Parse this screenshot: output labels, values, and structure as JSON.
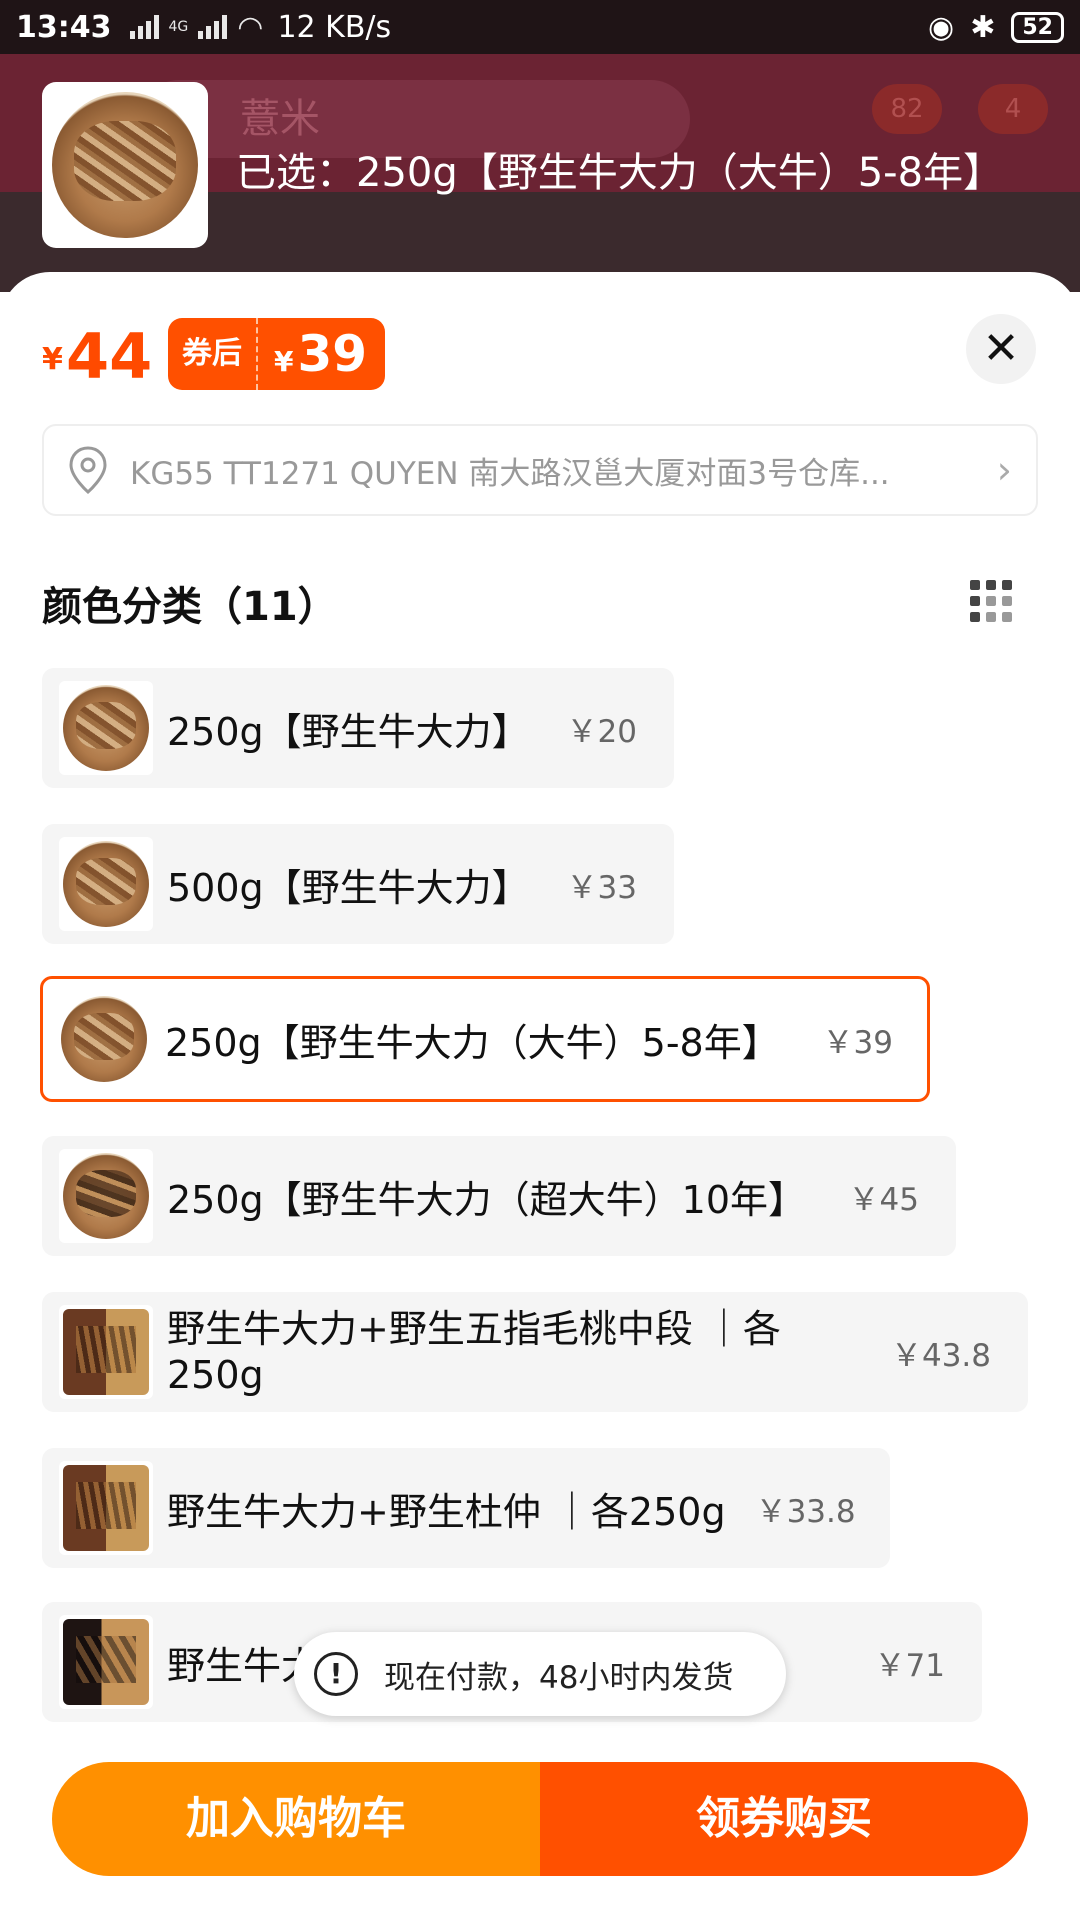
{
  "status_bar": {
    "time": "13:43",
    "network_speed": "12 KB/s",
    "battery": "52",
    "network_label": "4G"
  },
  "background_page": {
    "search_text": "薏米",
    "cart_badge": "82",
    "message_badge": "4"
  },
  "header": {
    "selected_text": "已选：250g【野生牛大力（大牛）5-8年】"
  },
  "price": {
    "currency": "¥",
    "current": "44",
    "coupon_label": "券后",
    "coupon_currency": "¥",
    "coupon_price": "39"
  },
  "address": {
    "text": "KG55 TT1271 QUYEN 南大路汉邕大厦对面3号仓库..."
  },
  "section": {
    "title": "颜色分类（11）"
  },
  "options": [
    {
      "label": "250g【野生牛大力】",
      "price": "￥20",
      "selected": false
    },
    {
      "label": "500g【野生牛大力】",
      "price": "￥33",
      "selected": false
    },
    {
      "label": "250g【野生牛大力（大牛）5-8年】",
      "price": "￥39",
      "selected": true
    },
    {
      "label": "250g【野生牛大力（超大牛）10年】",
      "price": "￥45",
      "selected": false
    },
    {
      "label": "野生牛大力+野生五指毛桃中段 ｜各250g",
      "price": "￥43.8",
      "selected": false
    },
    {
      "label": "野生牛大力+野生杜仲 ｜各250g",
      "price": "￥33.8",
      "selected": false
    },
    {
      "label": "野生牛大力+野生黑老虎 ｜各250g",
      "price": "￥71",
      "selected": false
    }
  ],
  "toast": {
    "text": "现在付款，48小时内发货"
  },
  "buttons": {
    "add_to_cart": "加入购物车",
    "buy_with_coupon": "领券购买"
  },
  "colors": {
    "accent": "#ff5000",
    "cart_button": "#ff9000",
    "price": "#ff4a00"
  }
}
